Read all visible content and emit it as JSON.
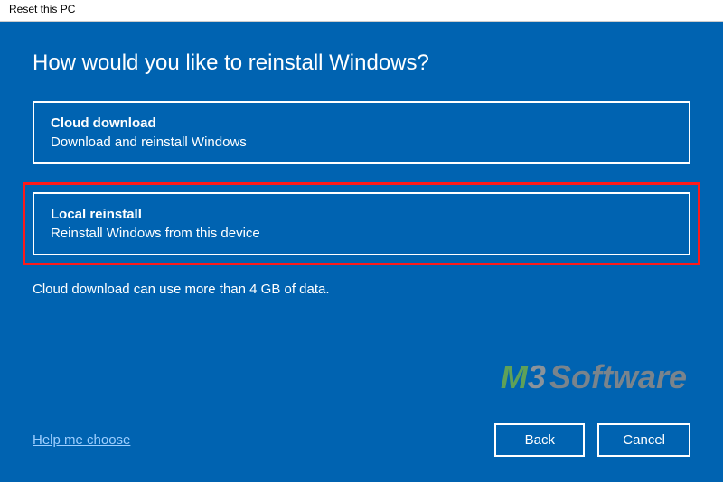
{
  "titlebar": {
    "title": "Reset this PC"
  },
  "dialog": {
    "heading": "How would you like to reinstall Windows?",
    "options": [
      {
        "title": "Cloud download",
        "description": "Download and reinstall Windows"
      },
      {
        "title": "Local reinstall",
        "description": "Reinstall Windows from this device"
      }
    ],
    "note": "Cloud download can use more than 4 GB of data.",
    "help_link": "Help me choose",
    "buttons": {
      "back": "Back",
      "cancel": "Cancel"
    }
  },
  "watermark": {
    "part1": "M",
    "part2": "3",
    "part3": "Software"
  }
}
